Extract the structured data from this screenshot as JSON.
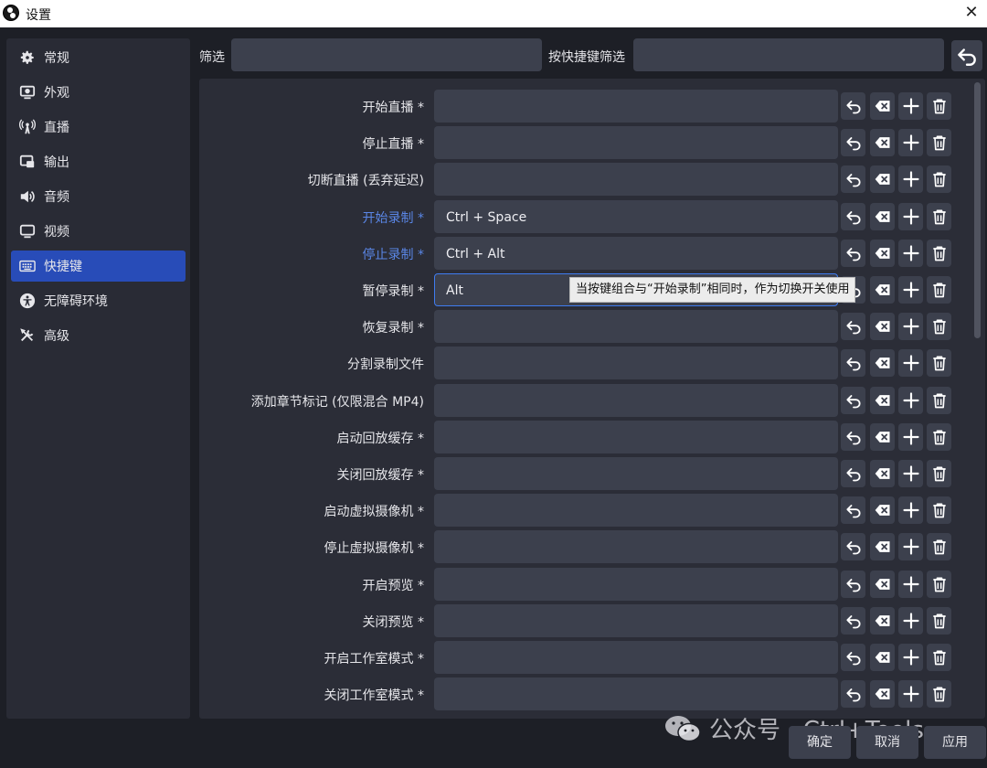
{
  "window": {
    "title": "设置",
    "close_icon": "close-icon"
  },
  "sidebar": {
    "items": [
      {
        "label": "常规",
        "icon": "gear-icon"
      },
      {
        "label": "外观",
        "icon": "appearance-icon"
      },
      {
        "label": "直播",
        "icon": "broadcast-icon"
      },
      {
        "label": "输出",
        "icon": "output-icon"
      },
      {
        "label": "音频",
        "icon": "speaker-icon"
      },
      {
        "label": "视频",
        "icon": "monitor-icon"
      },
      {
        "label": "快捷键",
        "icon": "keyboard-icon",
        "active": true
      },
      {
        "label": "无障碍环境",
        "icon": "accessibility-icon"
      },
      {
        "label": "高级",
        "icon": "tools-icon"
      }
    ]
  },
  "filter": {
    "label": "筛选",
    "value": "",
    "hotkey_label": "按快捷键筛选",
    "hotkey_value": ""
  },
  "hotkeys": [
    {
      "label": "开始直播 *",
      "value": "",
      "highlight": false
    },
    {
      "label": "停止直播 *",
      "value": "",
      "highlight": false
    },
    {
      "label": "切断直播 (丢弃延迟)",
      "value": "",
      "highlight": false
    },
    {
      "label": "开始录制 *",
      "value": "Ctrl + Space",
      "highlight": true
    },
    {
      "label": "停止录制 *",
      "value": "Ctrl + Alt",
      "highlight": true
    },
    {
      "label": "暂停录制 *",
      "value": "Alt",
      "highlight": false,
      "focused": true
    },
    {
      "label": "恢复录制 *",
      "value": "",
      "highlight": false
    },
    {
      "label": "分割录制文件",
      "value": "",
      "highlight": false
    },
    {
      "label": "添加章节标记 (仅限混合 MP4)",
      "value": "",
      "highlight": false
    },
    {
      "label": "启动回放缓存 *",
      "value": "",
      "highlight": false
    },
    {
      "label": "关闭回放缓存 *",
      "value": "",
      "highlight": false
    },
    {
      "label": "启动虚拟摄像机 *",
      "value": "",
      "highlight": false
    },
    {
      "label": "停止虚拟摄像机 *",
      "value": "",
      "highlight": false
    },
    {
      "label": "开启预览 *",
      "value": "",
      "highlight": false
    },
    {
      "label": "关闭预览 *",
      "value": "",
      "highlight": false
    },
    {
      "label": "开启工作室模式 *",
      "value": "",
      "highlight": false
    },
    {
      "label": "关闭工作室模式 *",
      "value": "",
      "highlight": false
    }
  ],
  "tooltip": "当按键组合与“开始录制”相同时，作为切换开关使用",
  "buttons": {
    "ok": "确定",
    "cancel": "取消",
    "apply": "应用"
  },
  "watermark": "公众号 · Ctrl+Tools",
  "colors": {
    "accent": "#284cb8",
    "highlight_label": "#5a86e6",
    "focus_border": "#3f7cf0"
  }
}
